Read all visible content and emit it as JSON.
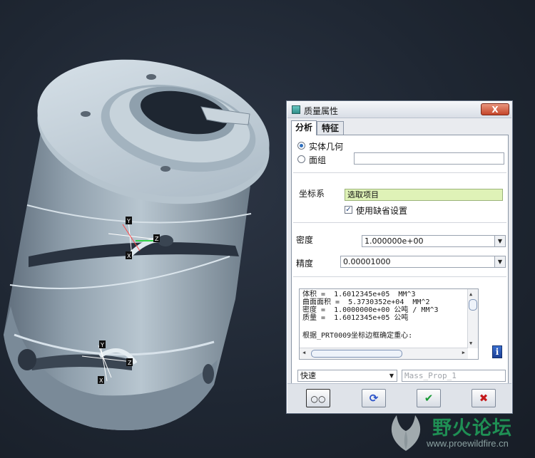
{
  "dialog": {
    "title": "质量属性",
    "close_label": "X",
    "tabs": [
      {
        "label": "分析",
        "active": true
      },
      {
        "label": "特征",
        "active": false
      }
    ],
    "geometry_options": [
      {
        "label": "实体几何",
        "checked": true
      },
      {
        "label": "面组",
        "checked": false
      }
    ],
    "quilt_field_value": "",
    "csys_label": "坐标系",
    "csys_value": "选取项目",
    "use_default_label": "使用缺省设置",
    "use_default_checked": true,
    "density_label": "密度",
    "density_value": "1.000000e+00",
    "accuracy_label": "精度",
    "accuracy_value": "0.00001000",
    "results_lines": [
      "体积 =  1.6012345e+05  MM^3",
      "曲面面积 =  5.3730352e+04  MM^2",
      "密度 =  1.0000000e+00 公吨 / MM^3",
      "质量 =  1.6012345e+05 公吨",
      "",
      "根据_PRT0009坐标边框确定重心:"
    ],
    "mode_value": "快速",
    "name_placeholder": "Mass_Prop_1",
    "colors": {
      "valid_selection": "#dff2b7",
      "ok": "#1a9a36",
      "cancel": "#c4191b"
    }
  },
  "viewport": {
    "csys_labels": [
      "Y",
      "Z",
      "X",
      "Y",
      "Z",
      "X"
    ]
  },
  "watermark": {
    "text": "野火论坛",
    "url": "www.proewildfire.cn"
  }
}
